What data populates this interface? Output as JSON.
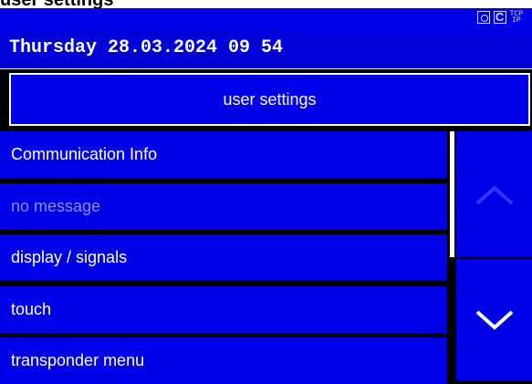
{
  "window": {
    "title": "user settings"
  },
  "status": {
    "icons": [
      "wireless-icon",
      "c-icon",
      "tcp-ip-icon"
    ],
    "tcp_label": "TCP",
    "ip_label": "IP"
  },
  "header": {
    "datetime": "Thursday  28.03.2024  09 54"
  },
  "title_button": {
    "label": "user settings"
  },
  "menu": {
    "items": [
      {
        "label": "Communication Info",
        "enabled": true
      },
      {
        "label": "no message",
        "enabled": false
      },
      {
        "label": "display / signals",
        "enabled": true
      },
      {
        "label": "touch",
        "enabled": true
      },
      {
        "label": "transponder menu",
        "enabled": true
      }
    ]
  },
  "nav": {
    "up": "chevron-up-icon",
    "down": "chevron-down-icon"
  },
  "colors": {
    "background": "#000000",
    "panel": "#0000e8",
    "text": "#ffffff",
    "disabled_text": "#8d8dea"
  }
}
